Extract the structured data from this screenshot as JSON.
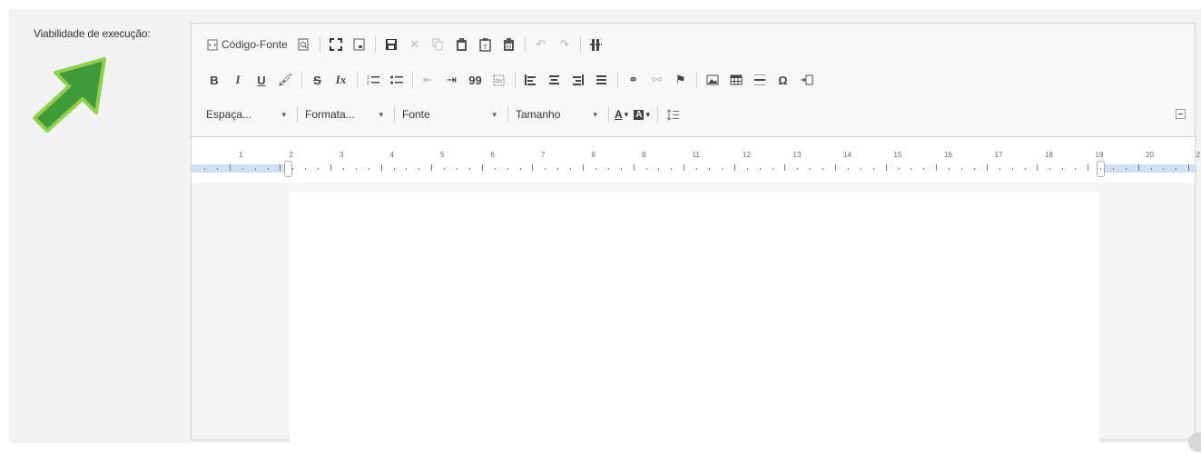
{
  "field": {
    "label": "Viabilidade de execução:"
  },
  "colors": {
    "arrow": "#3f9b3a",
    "arrow_outline": "#8fd24a",
    "ruler_band": "#cfe0f5"
  },
  "toolbar": {
    "row1": {
      "source_label": "Código-Fonte",
      "buttons": [
        "preview-icon",
        "maximize-icon",
        "show-blocks-icon",
        "save-icon",
        "cut-icon",
        "copy-icon",
        "paste-icon",
        "paste-text-icon",
        "paste-word-icon",
        "undo-icon",
        "redo-icon",
        "page-break-icon"
      ]
    },
    "row2": {
      "bold": "B",
      "italic": "I",
      "underline": "U",
      "strike": "S",
      "remove_format": "Ix",
      "blockquote": "99",
      "omega": "Ω"
    },
    "row3": {
      "spacing": "Espaça...",
      "format": "Formata...",
      "font": "Fonte",
      "size": "Tamanho",
      "text_color": "A",
      "bg_color": "A"
    }
  },
  "ruler": {
    "numbers": [
      "1",
      "2",
      "3",
      "4",
      "5",
      "6",
      "7",
      "8",
      "9",
      "11",
      "12",
      "13",
      "14",
      "15",
      "16",
      "17",
      "18",
      "19",
      "20",
      "2"
    ]
  }
}
